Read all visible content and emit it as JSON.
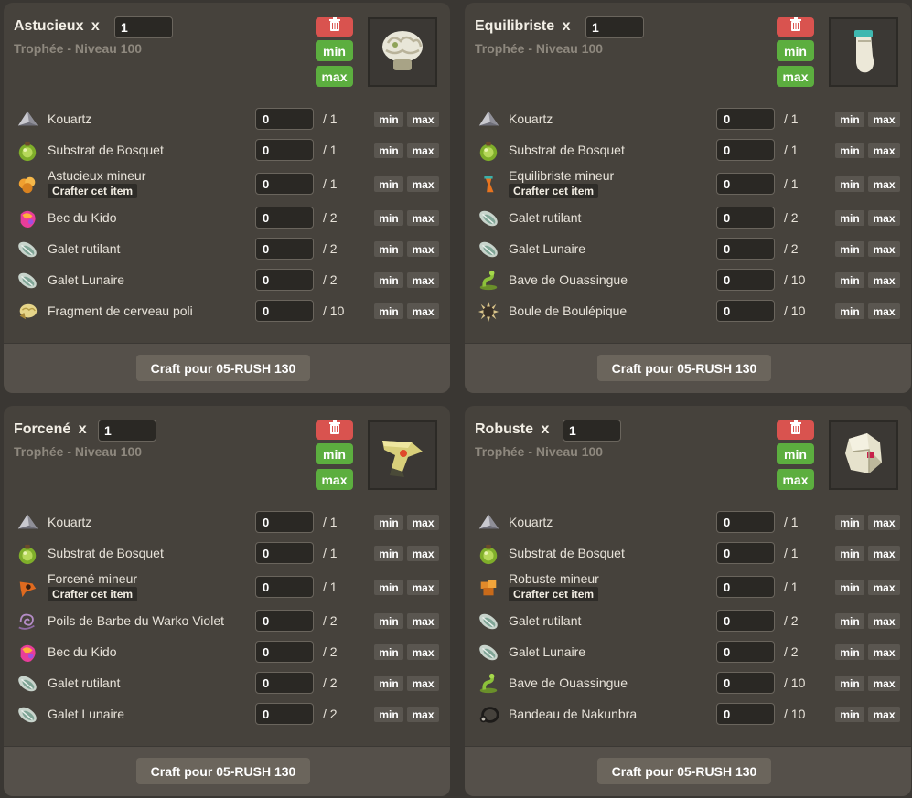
{
  "labels": {
    "multiply": "x",
    "min": "min",
    "max": "max",
    "crafter": "Crafter cet item",
    "craft_button": "Craft pour 05-RUSH 130"
  },
  "colors": {
    "delete": "#d9534f",
    "minmax_green": "#5cae3f",
    "card_bg": "#46423c"
  },
  "cards": [
    {
      "name": "Astucieux",
      "quantity": "1",
      "subtitle": "Trophée - Niveau 100",
      "icon": "brain-trophy-icon",
      "ingredients": [
        {
          "name": "Kouartz",
          "value": "0",
          "required": "/ 1",
          "icon": "kouartz-icon"
        },
        {
          "name": "Substrat de Bosquet",
          "value": "0",
          "required": "/ 1",
          "icon": "substrat-icon"
        },
        {
          "name": "Astucieux mineur",
          "value": "0",
          "required": "/ 1",
          "icon": "astucieux-mineur-icon",
          "craftable": true
        },
        {
          "name": "Bec du Kido",
          "value": "0",
          "required": "/ 2",
          "icon": "bec-kido-icon"
        },
        {
          "name": "Galet rutilant",
          "value": "0",
          "required": "/ 2",
          "icon": "galet-rutilant-icon"
        },
        {
          "name": "Galet Lunaire",
          "value": "0",
          "required": "/ 2",
          "icon": "galet-lunaire-icon"
        },
        {
          "name": "Fragment de cerveau poli",
          "value": "0",
          "required": "/ 10",
          "icon": "cerveau-icon"
        }
      ]
    },
    {
      "name": "Equilibriste",
      "quantity": "1",
      "subtitle": "Trophée - Niveau 100",
      "icon": "foot-trophy-icon",
      "ingredients": [
        {
          "name": "Kouartz",
          "value": "0",
          "required": "/ 1",
          "icon": "kouartz-icon"
        },
        {
          "name": "Substrat de Bosquet",
          "value": "0",
          "required": "/ 1",
          "icon": "substrat-icon"
        },
        {
          "name": "Equilibriste mineur",
          "value": "0",
          "required": "/ 1",
          "icon": "equilibriste-mineur-icon",
          "craftable": true
        },
        {
          "name": "Galet rutilant",
          "value": "0",
          "required": "/ 2",
          "icon": "galet-rutilant-icon"
        },
        {
          "name": "Galet Lunaire",
          "value": "0",
          "required": "/ 2",
          "icon": "galet-lunaire-icon"
        },
        {
          "name": "Bave de Ouassingue",
          "value": "0",
          "required": "/ 10",
          "icon": "bave-icon"
        },
        {
          "name": "Boule de Boulépique",
          "value": "0",
          "required": "/ 10",
          "icon": "boule-icon"
        }
      ]
    },
    {
      "name": "Forcené",
      "quantity": "1",
      "subtitle": "Trophée - Niveau 100",
      "icon": "anvil-trophy-icon",
      "ingredients": [
        {
          "name": "Kouartz",
          "value": "0",
          "required": "/ 1",
          "icon": "kouartz-icon"
        },
        {
          "name": "Substrat de Bosquet",
          "value": "0",
          "required": "/ 1",
          "icon": "substrat-icon"
        },
        {
          "name": "Forcené mineur",
          "value": "0",
          "required": "/ 1",
          "icon": "forcene-mineur-icon",
          "craftable": true
        },
        {
          "name": "Poils de Barbe du Warko Violet",
          "value": "0",
          "required": "/ 2",
          "icon": "poils-icon"
        },
        {
          "name": "Bec du Kido",
          "value": "0",
          "required": "/ 2",
          "icon": "bec-kido-icon"
        },
        {
          "name": "Galet rutilant",
          "value": "0",
          "required": "/ 2",
          "icon": "galet-rutilant-icon"
        },
        {
          "name": "Galet Lunaire",
          "value": "0",
          "required": "/ 2",
          "icon": "galet-lunaire-icon"
        }
      ]
    },
    {
      "name": "Robuste",
      "quantity": "1",
      "subtitle": "Trophée - Niveau 100",
      "icon": "rock-trophy-icon",
      "ingredients": [
        {
          "name": "Kouartz",
          "value": "0",
          "required": "/ 1",
          "icon": "kouartz-icon"
        },
        {
          "name": "Substrat de Bosquet",
          "value": "0",
          "required": "/ 1",
          "icon": "substrat-icon"
        },
        {
          "name": "Robuste mineur",
          "value": "0",
          "required": "/ 1",
          "icon": "robuste-mineur-icon",
          "craftable": true
        },
        {
          "name": "Galet rutilant",
          "value": "0",
          "required": "/ 2",
          "icon": "galet-rutilant-icon"
        },
        {
          "name": "Galet Lunaire",
          "value": "0",
          "required": "/ 2",
          "icon": "galet-lunaire-icon"
        },
        {
          "name": "Bave de Ouassingue",
          "value": "0",
          "required": "/ 10",
          "icon": "bave-icon"
        },
        {
          "name": "Bandeau de Nakunbra",
          "value": "0",
          "required": "/ 10",
          "icon": "bandeau-icon"
        }
      ]
    }
  ]
}
